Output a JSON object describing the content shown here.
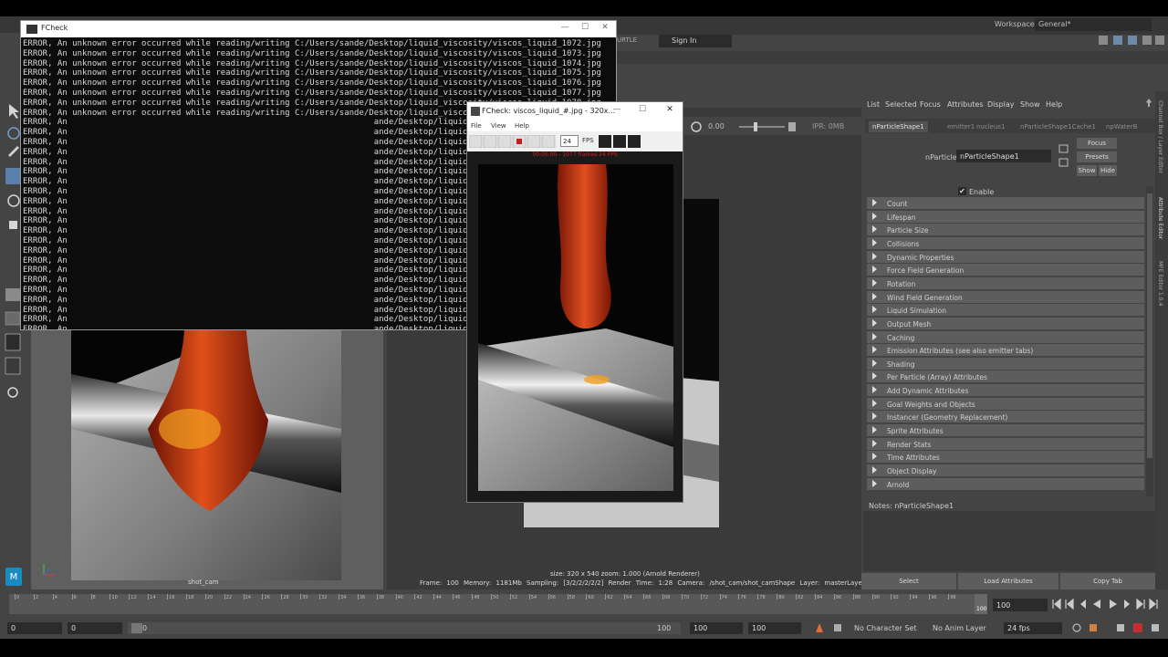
{
  "workspace": {
    "label": "Workspace:",
    "value": "General*"
  },
  "signin": {
    "label": "Sign In"
  },
  "shelf": {
    "turtle_tab": "URTLE"
  },
  "console": {
    "title": "FCheck",
    "lines": [
      "ERROR, An unknown error occurred while reading/writing C:/Users/sande/Desktop/liquid_viscosity/viscos_liquid_1072.jpg",
      "ERROR, An unknown error occurred while reading/writing C:/Users/sande/Desktop/liquid_viscosity/viscos_liquid_1073.jpg",
      "ERROR, An unknown error occurred while reading/writing C:/Users/sande/Desktop/liquid_viscosity/viscos_liquid_1074.jpg",
      "ERROR, An unknown error occurred while reading/writing C:/Users/sande/Desktop/liquid_viscosity/viscos_liquid_1075.jpg",
      "ERROR, An unknown error occurred while reading/writing C:/Users/sande/Desktop/liquid_viscosity/viscos_liquid_1076.jpg",
      "ERROR, An unknown error occurred while reading/writing C:/Users/sande/Desktop/liquid_viscosity/viscos_liquid_1077.jpg",
      "ERROR, An unknown error occurred while reading/writing C:/Users/sande/Desktop/liquid_viscosity/viscos_liquid_1078.jpg",
      "ERROR, An unknown error occurred while reading/writing C:/Users/sande/Desktop/liquid_viscosity/viscos",
      "ERROR, An                                                              ande/Desktop/liquid_viscos",
      "ERROR, An                                                              ande/Desktop/liquid_viscos",
      "ERROR, An                                                              ande/Desktop/liquid_viscos",
      "ERROR, An                                                              ande/Desktop/liquid_viscos",
      "ERROR, An                                                              ande/Desktop/liquid_viscos",
      "ERROR, An                                                              ande/Desktop/liquid_viscos",
      "ERROR, An                                                              ande/Desktop/liquid_viscos",
      "ERROR, An                                                              ande/Desktop/liquid_viscos",
      "ERROR, An                                                              ande/Desktop/liquid_viscos",
      "ERROR, An                                                              ande/Desktop/liquid_viscos",
      "ERROR, An                                                              ande/Desktop/liquid_viscos",
      "ERROR, An                                                              ande/Desktop/liquid_viscos",
      "ERROR, An                                                              ande/Desktop/liquid_viscos",
      "ERROR, An                                                              ande/Desktop/liquid_viscos",
      "ERROR, An                                                              ande/Desktop/liquid_viscos",
      "ERROR, An                                                              ande/Desktop/liquid_viscos",
      "ERROR, An                                                              ande/Desktop/liquid_viscos",
      "ERROR, An                                                              ande/Desktop/liquid_viscos",
      "ERROR, An                                                              ande/Desktop/liquid_viscos",
      "ERROR, An                                                              ande/Desktop/liquid_viscos",
      "ERROR, An                                                              ande/Desktop/liquid_viscos",
      "ERROR, An                                                              ande/Desktop/liquid_viscos"
    ]
  },
  "viewport": {
    "camera_label": "shot_cam"
  },
  "render_view": {
    "value": "0.00",
    "ipr": "IPR: 0MB",
    "size_line": "size: 320 x 540  zoom: 1.000     (Arnold Renderer)",
    "status": "Frame: 100   Memory: 1181Mb   Sampling: [3/2/2/2/2/2]   Render Time: 1:28   Camera: /shot_cam/shot_camShape   Layer: masterLayer"
  },
  "fcheck": {
    "title": "FCheck: viscos_liquid_#.jpg - 320x...",
    "menu": [
      "File",
      "View",
      "Help"
    ],
    "fps_value": "24",
    "fps_label": "FPS",
    "info": "00:00:00 - 1077 frames 24 FPS"
  },
  "attribute_editor": {
    "menu": [
      "List",
      "Selected",
      "Focus",
      "Attributes",
      "Display",
      "Show",
      "Help"
    ],
    "tabs": [
      "nParticleShape1",
      "emitter1",
      "nucleus1",
      "nParticleShape1Cache1",
      "npWaterB"
    ],
    "field_label": "nParticle:",
    "field_value": "nParticleShape1",
    "buttons": {
      "focus": "Focus",
      "presets": "Presets",
      "show": "Show",
      "hide": "Hide"
    },
    "enable_label": "Enable",
    "sections": [
      "Count",
      "Lifespan",
      "Particle Size",
      "Collisions",
      "Dynamic Properties",
      "Force Field Generation",
      "Rotation",
      "Wind Field Generation",
      "Liquid Simulation",
      "Output Mesh",
      "Caching",
      "Emission Attributes (see also emitter tabs)",
      "Shading",
      "Per Particle (Array) Attributes",
      "Add Dynamic Attributes",
      "Goal Weights and Objects",
      "Instancer (Geometry Replacement)",
      "Sprite Attributes",
      "Render Stats",
      "Time Attributes",
      "Object Display",
      "Arnold"
    ],
    "notes_label": "Notes:  nParticleShape1",
    "bottom_buttons": [
      "Select",
      "Load Attributes",
      "Copy Tab"
    ],
    "side_tabs": [
      "Channel Box / Layer Editor",
      "Attribute Editor",
      "MFE Editor 1.0.4"
    ]
  },
  "timeline": {
    "ticks": [
      "0",
      "2",
      "4",
      "6",
      "8",
      "10",
      "12",
      "14",
      "16",
      "18",
      "20",
      "22",
      "24",
      "26",
      "28",
      "30",
      "32",
      "34",
      "36",
      "38",
      "40",
      "42",
      "44",
      "46",
      "48",
      "50",
      "52",
      "54",
      "56",
      "58",
      "60",
      "62",
      "64",
      "66",
      "68",
      "70",
      "72",
      "74",
      "76",
      "78",
      "80",
      "82",
      "84",
      "86",
      "88",
      "90",
      "92",
      "94",
      "96",
      "98"
    ],
    "current_frame": "100",
    "current_time": "100"
  },
  "range": {
    "start_field": "0",
    "anim_start": "0",
    "slider_start": "0",
    "slider_end": "100",
    "anim_end": "100",
    "end_field": "100",
    "character_set": "No Character Set",
    "anim_layer": "No Anim Layer",
    "fps": "24 fps"
  },
  "colors": {
    "maya_bg": "#444444",
    "panel_dark": "#2b2b2b",
    "error_red": "#e02020",
    "liquid_orange": "#c84010"
  }
}
